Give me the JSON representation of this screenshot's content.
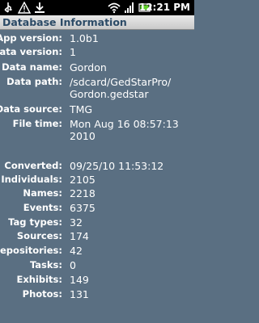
{
  "status_bar": {
    "time": "12:21",
    "ampm": "PM",
    "icons": [
      "usb-icon",
      "warning-icon",
      "download-icon",
      "wifi-icon",
      "battery-icon",
      "signal-icon"
    ]
  },
  "title": "Database Information",
  "rows": [
    {
      "label": "App version:",
      "value": [
        "1.0b1"
      ]
    },
    {
      "label": "Data version:",
      "value": [
        "1"
      ]
    },
    {
      "label": "Data name:",
      "value": [
        "Gordon"
      ]
    },
    {
      "label": "Data path:",
      "value": [
        "/sdcard/GedStarPro/",
        "Gordon.gedstar"
      ]
    },
    {
      "label": "Data source:",
      "value": [
        "TMG"
      ]
    },
    {
      "label": "File time:",
      "value": [
        "Mon Aug 16 08:57:13",
        "2010"
      ]
    },
    {
      "label": "Converted:",
      "value": [
        "09/25/10 11:53:12"
      ]
    },
    {
      "label": "Individuals:",
      "value": [
        "2105"
      ]
    },
    {
      "label": "Names:",
      "value": [
        "2218"
      ]
    },
    {
      "label": "Events:",
      "value": [
        "6375"
      ]
    },
    {
      "label": "Tag types:",
      "value": [
        "32"
      ]
    },
    {
      "label": "Sources:",
      "value": [
        "174"
      ]
    },
    {
      "label": "Repositories:",
      "value": [
        "42"
      ]
    },
    {
      "label": "Tasks:",
      "value": [
        "0"
      ]
    },
    {
      "label": "Exhibits:",
      "value": [
        "149"
      ]
    },
    {
      "label": "Photos:",
      "value": [
        "131"
      ]
    }
  ]
}
